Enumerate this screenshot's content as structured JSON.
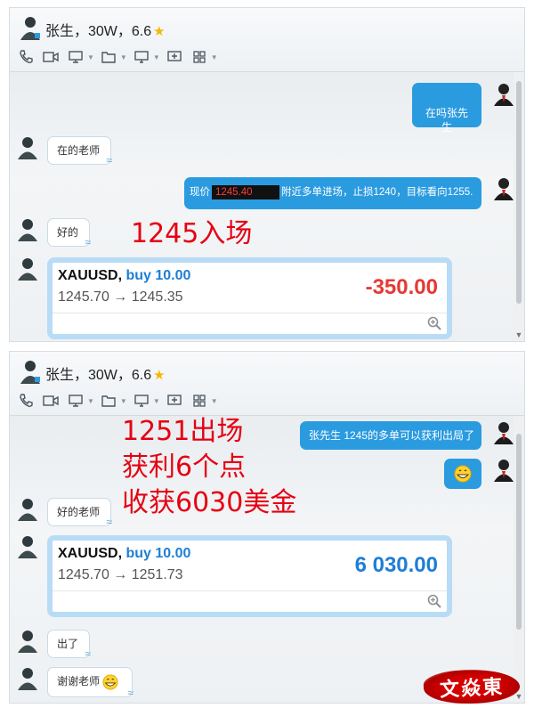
{
  "watermark": {
    "text": "文焱東"
  },
  "panel1": {
    "title": {
      "name": "张生，30W，6.6",
      "star": "★"
    },
    "messages": {
      "m1_out": "在吗张先生",
      "m2_in": "在的老师",
      "m3_out_prefix": "现价",
      "m3_out_price": "1245.40",
      "m3_out_suffix": "附近多单进场，止损1240，目标看向1255.",
      "m4_in": "好的"
    },
    "overlay": "1245入场",
    "trade": {
      "symbol": "XAUUSD,",
      "side": "buy 10.00",
      "prices": "1245.70 → 1245.35",
      "pl": "-350.00"
    }
  },
  "panel2": {
    "title": {
      "name": "张生，30W，6.6",
      "star": "★"
    },
    "messages": {
      "m1_out": "张先生  1245的多单可以获利出局了",
      "m3_in": "好的老师",
      "m4_in": "出了",
      "m5_in": "谢谢老师"
    },
    "overlay": [
      "1251出场",
      "获利6个点",
      "收获6030美金"
    ],
    "trade": {
      "symbol": "XAUUSD,",
      "side": "buy 10.00",
      "prices": "1245.70 → 1251.73",
      "pl": "6 030.00"
    }
  },
  "icons": [
    "phone-icon",
    "video-icon",
    "screen-share-icon",
    "folder-icon",
    "remote-desktop-icon",
    "add-chat-icon",
    "apps-icon",
    "zoom-icon",
    "grin-emoji-icon"
  ],
  "colors": {
    "bubble_out": "#2b9be0",
    "overlay_text": "#e60012",
    "pl_negative": "#e53935",
    "pl_positive": "#1e7ed6"
  }
}
